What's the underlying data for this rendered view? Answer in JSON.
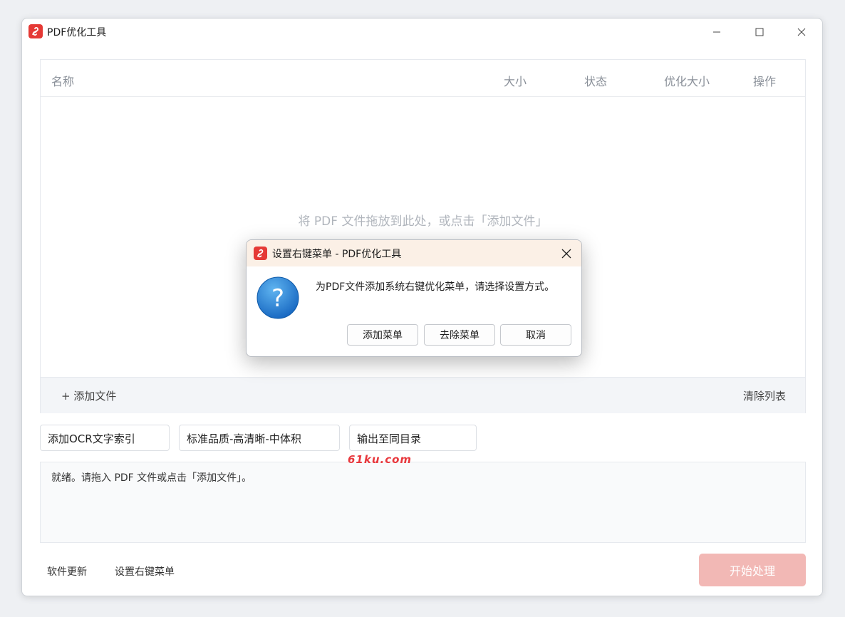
{
  "window": {
    "title": "PDF优化工具",
    "icons": {
      "logo": "pdf-logo-icon",
      "minimize": "minimize-icon",
      "maximize": "maximize-icon",
      "close": "close-icon"
    }
  },
  "file_list": {
    "columns": {
      "name": "名称",
      "size": "大小",
      "status": "状态",
      "optimized_size": "优化大小",
      "actions": "操作"
    },
    "empty_hint": "将 PDF 文件拖放到此处，或点击「添加文件」",
    "add_file": "+ 添加文件",
    "clear_list": "清除列表"
  },
  "options": {
    "ocr": "添加OCR文字索引",
    "quality": "标准品质-高清晰-中体积",
    "output": "输出至同目录"
  },
  "watermark": "61ku.com",
  "log": {
    "text": "就绪。请拖入 PDF 文件或点击「添加文件」。"
  },
  "footer": {
    "update": "软件更新",
    "context_menu": "设置右键菜单",
    "start": "开始处理"
  },
  "dialog": {
    "title": "设置右键菜单 - PDF优化工具",
    "message": "为PDF文件添加系统右键优化菜单，请选择设置方式。",
    "buttons": {
      "add": "添加菜单",
      "remove": "去除菜单",
      "cancel": "取消"
    },
    "icon": "question-icon"
  },
  "colors": {
    "brand": "#e53935",
    "start_button_disabled": "#f2b8b5",
    "question_icon": "#1f7fd4",
    "dialog_titlebar": "#fbf0e6"
  }
}
